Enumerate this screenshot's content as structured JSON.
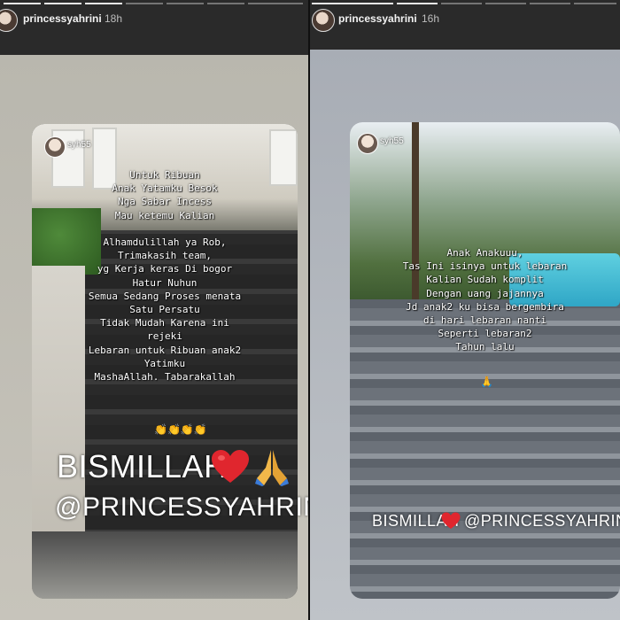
{
  "left_story": {
    "username": "princessyahrini",
    "time": "18h",
    "repost_user": "syh55",
    "caption": "Untuk Ribuan\nAnak Yatamku Besok\nNga Sabar Incess\nMau ketemu Kalian\n\nAlhamdulillah ya Rob,\nTrimakasih team,\nyg Kerja keras Di bogor\nHatur Nuhun\nSemua Sedang Proses menata\nSatu Persatu\nTidak Mudah Karena ini\nrejeki\nLebaran untuk Ribuan anak2\nYatimku\nMashaAllah. Tabarakallah",
    "emoji_hands": "👏👏👏👏",
    "big_text": "BISMILLAH",
    "handle": "@PRINCESSYAHRINI"
  },
  "right_story": {
    "username": "princessyahrini",
    "time": "16h",
    "repost_user": "syh55",
    "caption": "Anak Anakuuu,\nTas Ini isinya untuk lebaran\nKalian Sudah komplit\nDengan uang jajannya\nJd anak2 ku bisa bergembira\ndi hari lebaran nanti\nSeperti lebaran2\nTahun lalu",
    "emoji_hands": "🙏",
    "bottom_left": "BISMILLAH",
    "bottom_right": "@PRINCESSYAHRINI"
  },
  "colors": {
    "heart": "#e0262e",
    "pray": "#f2b84a"
  }
}
